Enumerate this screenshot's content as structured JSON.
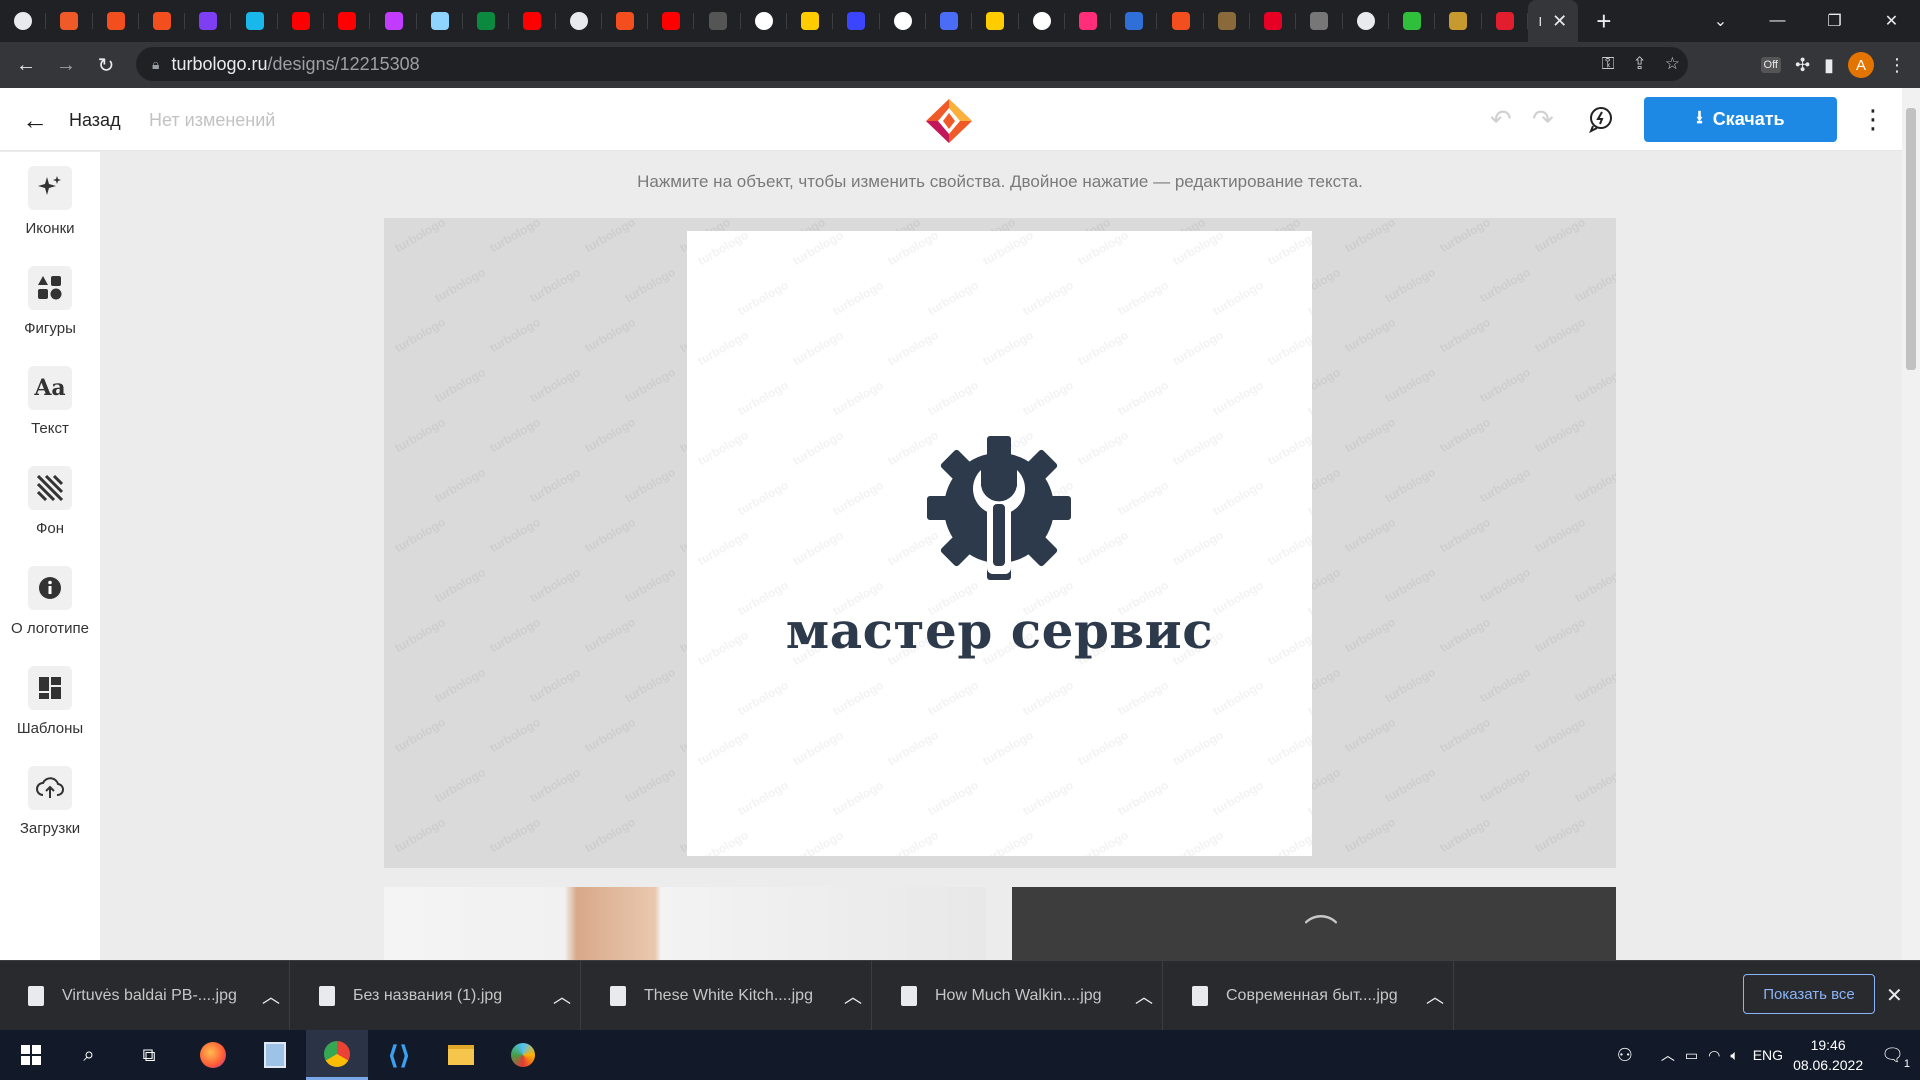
{
  "browser": {
    "tab_favicons": [
      {
        "icon": "chrome-globe-icon",
        "color": "#e8eaed"
      },
      {
        "icon": "turbologo-icon",
        "color": "#f05a28"
      },
      {
        "icon": "figma-icon",
        "color": "#f24e1e"
      },
      {
        "icon": "figma-icon",
        "color": "#f24e1e"
      },
      {
        "icon": "purple-u-icon",
        "color": "#7e3ff2"
      },
      {
        "icon": "vimeo-icon",
        "color": "#1ab7ea"
      },
      {
        "icon": "youtube-icon",
        "color": "#ff0000"
      },
      {
        "icon": "youtube-icon",
        "color": "#ff0000"
      },
      {
        "icon": "h-logo-icon",
        "color": "#c13cff"
      },
      {
        "icon": "snowflake-icon",
        "color": "#8fd3ff"
      },
      {
        "icon": "h-logo-icon",
        "color": "#0b8a3f"
      },
      {
        "icon": "youtube-icon",
        "color": "#ff0000"
      },
      {
        "icon": "globe-icon",
        "color": "#e8eaed"
      },
      {
        "icon": "figma-icon",
        "color": "#f24e1e"
      },
      {
        "icon": "youtube-icon",
        "color": "#ff0000"
      },
      {
        "icon": "swoosh-icon",
        "color": "#555555"
      },
      {
        "icon": "google-icon",
        "color": "#ffffff"
      },
      {
        "icon": "yandex-circle-icon",
        "color": "#ffcc00"
      },
      {
        "icon": "blue-ring-icon",
        "color": "#3b44ff"
      },
      {
        "icon": "google-icon",
        "color": "#ffffff"
      },
      {
        "icon": "blue-puzzle-icon",
        "color": "#4a6cf7"
      },
      {
        "icon": "play-yellow-icon",
        "color": "#ffcc00"
      },
      {
        "icon": "google-icon",
        "color": "#ffffff"
      },
      {
        "icon": "pink-arrow-icon",
        "color": "#ff2d7a"
      },
      {
        "icon": "calendar-icon",
        "color": "#2f6fd8"
      },
      {
        "icon": "figma-icon",
        "color": "#f24e1e"
      },
      {
        "icon": "book-icon",
        "color": "#8a6a3a"
      },
      {
        "icon": "pinterest-icon",
        "color": "#e60023"
      },
      {
        "icon": "drop-icon",
        "color": "#777777"
      },
      {
        "icon": "globe-icon",
        "color": "#e8eaed"
      },
      {
        "icon": "green-face-icon",
        "color": "#2fbf3a"
      },
      {
        "icon": "tree-icon",
        "color": "#c79a2f"
      },
      {
        "icon": "red-stop-icon",
        "color": "#e11d2e"
      }
    ],
    "active_tab_label": "I",
    "url_domain": "turbologo.ru",
    "url_path": "/designs/12215308",
    "profile_initial": "A",
    "extension_badge": "Off"
  },
  "header": {
    "back_label": "Назад",
    "status": "Нет изменений",
    "download_label": "Скачать"
  },
  "sidebar": {
    "items": [
      {
        "label": "Иконки",
        "icon": "sparkle-icon"
      },
      {
        "label": "Фигуры",
        "icon": "shapes-icon"
      },
      {
        "label": "Текст",
        "icon": "text-aa-icon"
      },
      {
        "label": "Фон",
        "icon": "background-stripes-icon"
      },
      {
        "label": "О логотипе",
        "icon": "info-icon"
      },
      {
        "label": "Шаблоны",
        "icon": "templates-grid-icon"
      },
      {
        "label": "Загрузки",
        "icon": "upload-cloud-icon"
      }
    ]
  },
  "workspace": {
    "hint": "Нажмите на объект, чтобы изменить свойства. Двойное нажатие — редактирование текста.",
    "logo_text": "мастер сервис",
    "logo_color": "#2c3a4b",
    "watermark": "turbologo"
  },
  "downloads": {
    "items": [
      {
        "name": "Virtuvės baldai PB-....jpg"
      },
      {
        "name": "Без названия (1).jpg"
      },
      {
        "name": "These White Kitch....jpg"
      },
      {
        "name": "How Much Walkin....jpg"
      },
      {
        "name": "Современная быт....jpg"
      }
    ],
    "show_all": "Показать все"
  },
  "taskbar": {
    "apps": [
      "windows-start-icon",
      "search-icon",
      "task-view-icon",
      "firefox-icon",
      "notepad-icon",
      "chrome-icon",
      "vscode-icon",
      "file-explorer-icon",
      "paint-icon"
    ],
    "lang": "ENG",
    "time": "19:46",
    "date": "08.06.2022",
    "notifications": "1"
  },
  "colors": {
    "accent": "#1e88e5",
    "chrome_dark": "#202124",
    "taskbar": "#121a2a"
  }
}
